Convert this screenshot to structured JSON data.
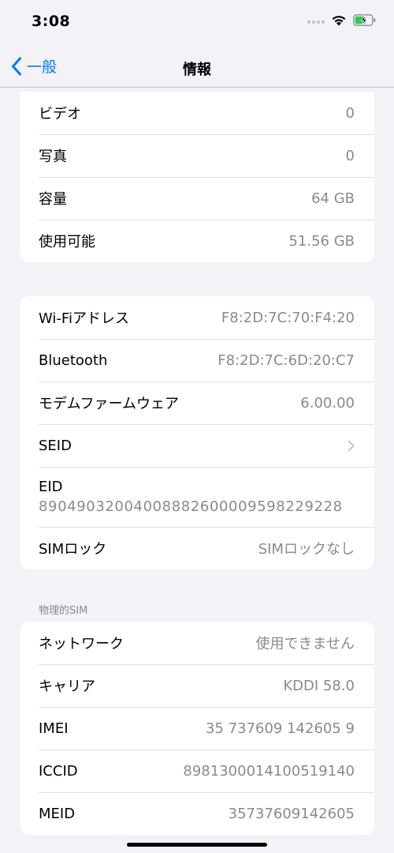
{
  "status": {
    "time": "3:08",
    "icons": [
      "signal-dots-icon",
      "wifi-icon",
      "battery-charging-icon"
    ],
    "battery_color": "#34c759"
  },
  "nav": {
    "back_label": "一般",
    "title": "情報",
    "accent_color": "#007aff"
  },
  "group1": {
    "rows": [
      {
        "label": "ビデオ",
        "value": "0"
      },
      {
        "label": "写真",
        "value": "0"
      },
      {
        "label": "容量",
        "value": "64 GB"
      },
      {
        "label": "使用可能",
        "value": "51.56 GB"
      }
    ]
  },
  "group2": {
    "wifi": {
      "label": "Wi-Fiアドレス",
      "value": "F8:2D:7C:70:F4:20"
    },
    "bluetooth": {
      "label": "Bluetooth",
      "value": "F8:2D:7C:6D:20:C7"
    },
    "modem": {
      "label": "モデムファームウェア",
      "value": "6.00.00"
    },
    "seid": {
      "label": "SEID"
    },
    "eid": {
      "label": "EID",
      "value": "89049032004008882600009598229228"
    },
    "simlock": {
      "label": "SIMロック",
      "value": "SIMロックなし"
    }
  },
  "group3": {
    "header": "物理的SIM",
    "rows": [
      {
        "label": "ネットワーク",
        "value": "使用できません"
      },
      {
        "label": "キャリア",
        "value": "KDDI 58.0"
      },
      {
        "label": "IMEI",
        "value": "35 737609 142605 9"
      },
      {
        "label": "ICCID",
        "value": "8981300014100519140"
      },
      {
        "label": "MEID",
        "value": "35737609142605"
      }
    ]
  }
}
